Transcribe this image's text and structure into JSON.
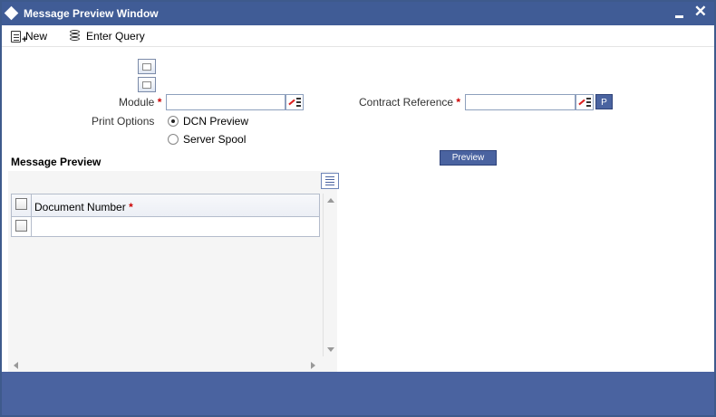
{
  "window": {
    "title": "Message Preview Window",
    "close_glyph": "✕"
  },
  "toolbar": {
    "new_label": "New",
    "enter_query_label": "Enter Query"
  },
  "form": {
    "module_label": "Module",
    "module_value": "",
    "contract_reference_label": "Contract Reference",
    "contract_reference_value": "",
    "required_mark": "*",
    "p_button_label": "P",
    "print_options_label": "Print Options",
    "print_options": [
      {
        "label": "DCN Preview",
        "selected": true
      },
      {
        "label": "Server Spool",
        "selected": false
      }
    ],
    "preview_button_label": "Preview"
  },
  "message_preview": {
    "section_title": "Message Preview",
    "columns": [
      {
        "label": "Document Number",
        "required": true
      }
    ],
    "rows": [
      {
        "document_number": "",
        "checked": false
      }
    ]
  },
  "colors": {
    "titlebar": "#405c96",
    "footer": "#4a63a0",
    "required": "#cc0000"
  }
}
